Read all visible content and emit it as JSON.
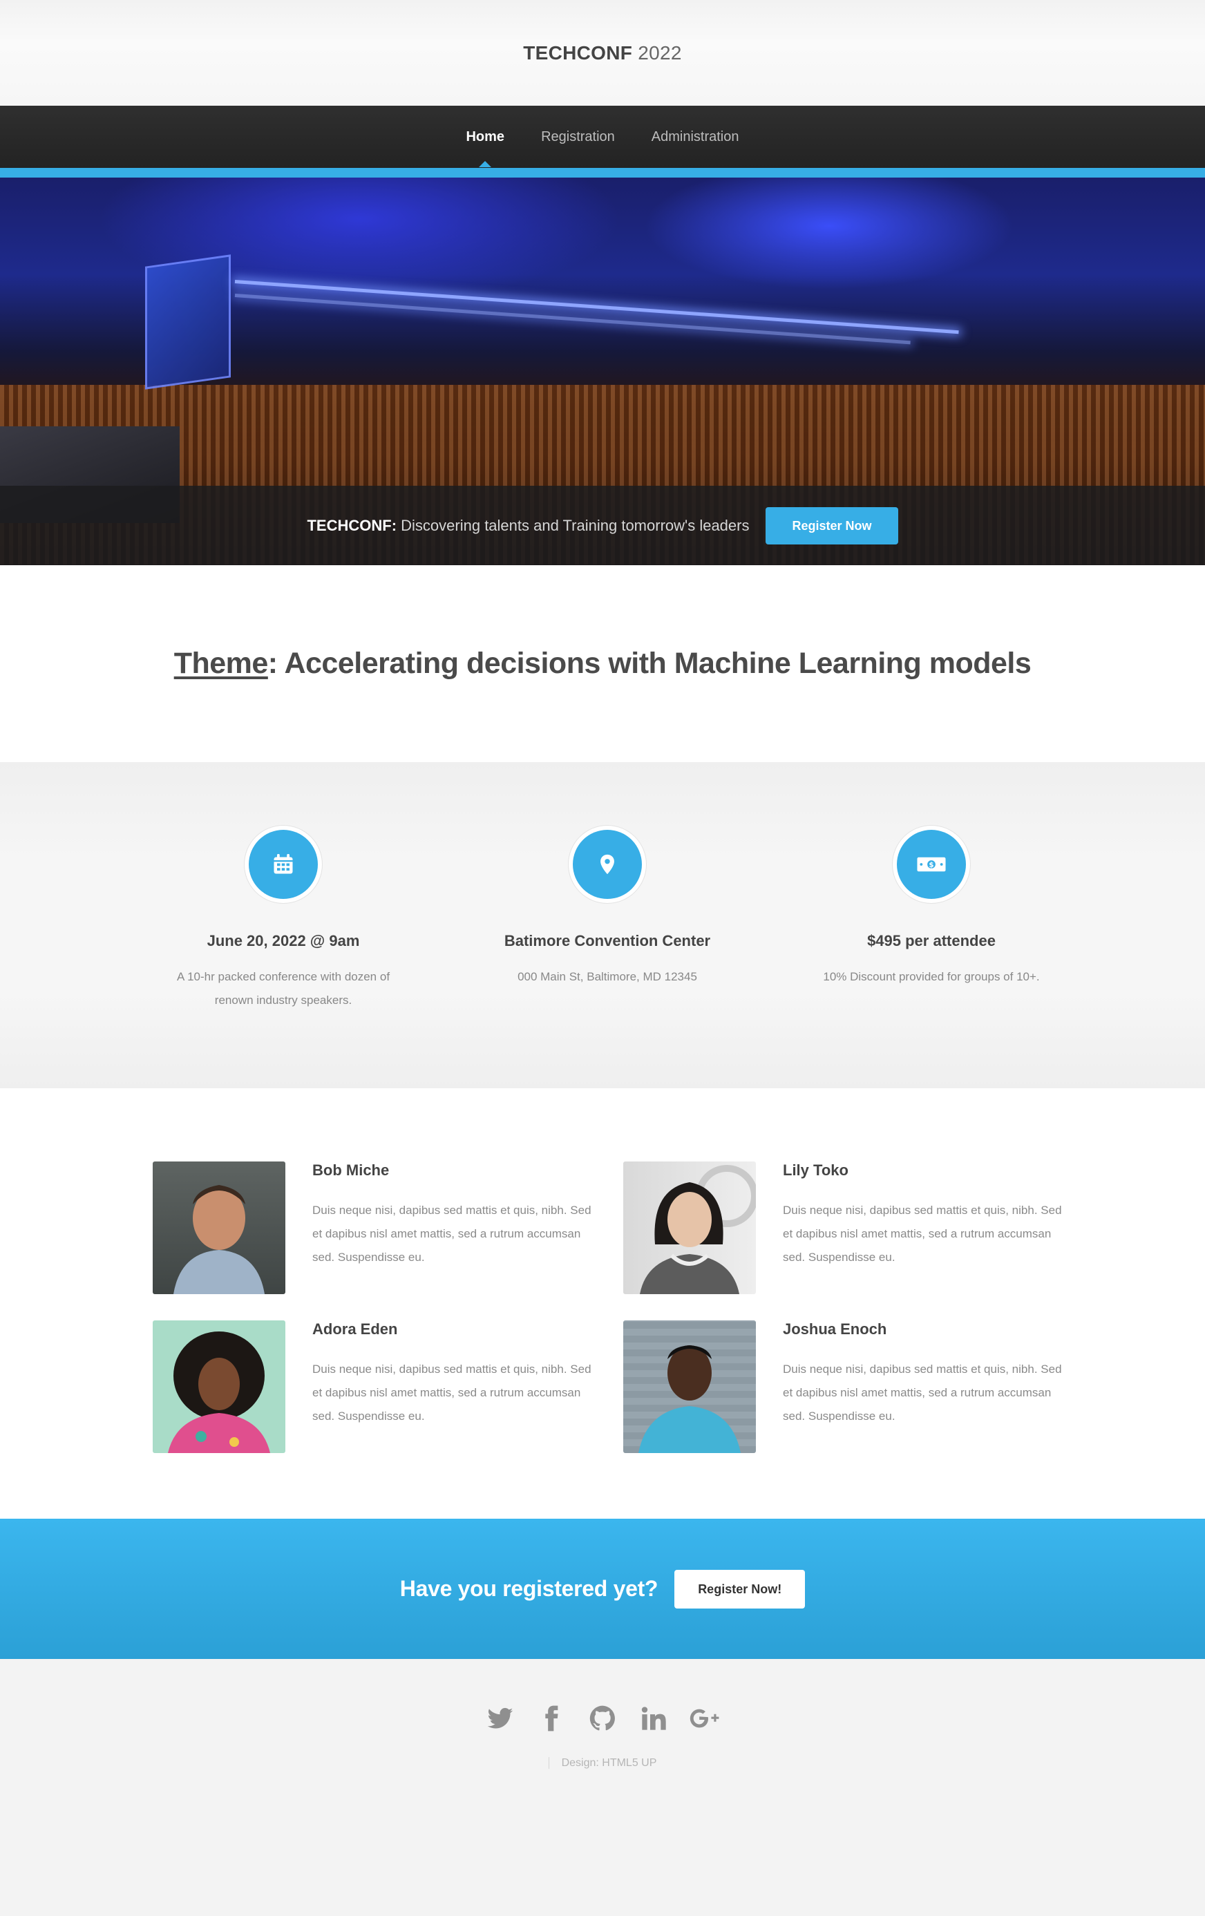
{
  "brand": {
    "name": "TECHCONF",
    "year": "2022"
  },
  "nav": {
    "items": [
      {
        "label": "Home",
        "active": true
      },
      {
        "label": "Registration",
        "active": false
      },
      {
        "label": "Administration",
        "active": false
      }
    ]
  },
  "hero": {
    "tagline_strong": "TECHCONF:",
    "tagline_text": "Discovering talents and Training tomorrow's leaders",
    "button_label": "Register Now"
  },
  "theme": {
    "label": "Theme",
    "text": ": Accelerating decisions with Machine Learning models"
  },
  "features": [
    {
      "icon": "calendar-icon",
      "title": "June 20, 2022 @ 9am",
      "text": "A 10-hr packed conference with dozen of renown industry speakers."
    },
    {
      "icon": "map-pin-icon",
      "title": "Batimore Convention Center",
      "text": "000 Main St, Baltimore, MD 12345"
    },
    {
      "icon": "money-icon",
      "title": "$495 per attendee",
      "text": "10% Discount provided for groups of 10+."
    }
  ],
  "speakers": [
    {
      "name": "Bob Miche",
      "bio": "Duis neque nisi, dapibus sed mattis et quis, nibh. Sed et dapibus nisl amet mattis, sed a rutrum accumsan sed. Suspendisse eu."
    },
    {
      "name": "Lily Toko",
      "bio": "Duis neque nisi, dapibus sed mattis et quis, nibh. Sed et dapibus nisl amet mattis, sed a rutrum accumsan sed. Suspendisse eu."
    },
    {
      "name": "Adora Eden",
      "bio": "Duis neque nisi, dapibus sed mattis et quis, nibh. Sed et dapibus nisl amet mattis, sed a rutrum accumsan sed. Suspendisse eu."
    },
    {
      "name": "Joshua Enoch",
      "bio": "Duis neque nisi, dapibus sed mattis et quis, nibh. Sed et dapibus nisl amet mattis, sed a rutrum accumsan sed. Suspendisse eu."
    }
  ],
  "cta": {
    "heading": "Have you registered yet?",
    "button_label": "Register Now!"
  },
  "footer": {
    "social_icons": [
      "twitter-icon",
      "facebook-icon",
      "github-icon",
      "linkedin-icon",
      "google-plus-icon"
    ],
    "credit": "Design: HTML5 UP"
  },
  "colors": {
    "accent": "#37aee6",
    "nav_bg": "#2a2a2a",
    "text": "#444444",
    "muted": "#8a8a8a"
  }
}
